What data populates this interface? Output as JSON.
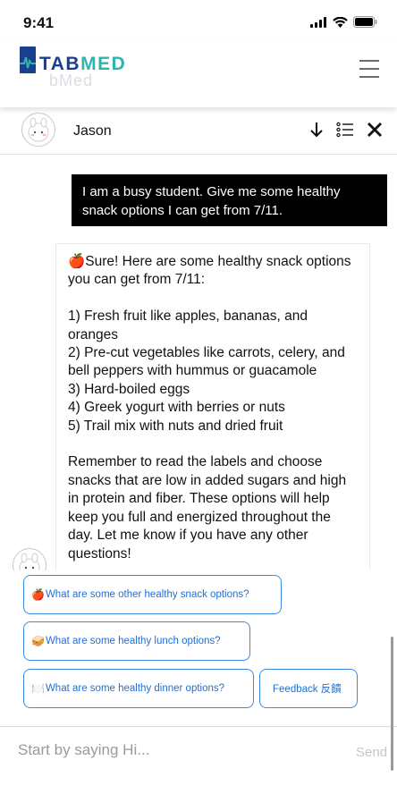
{
  "status_bar": {
    "time": "9:41"
  },
  "header": {
    "logo_part1": "TAB",
    "logo_part2": "MED",
    "logo_ghost": "bMed"
  },
  "chat": {
    "contact_name": "Jason",
    "user_message": "I am a busy student. Give me some healthy snack options I can get from 7/11.",
    "bot_message": "🍎Sure! Here are some healthy snack options you can get from 7/11:\n\n1) Fresh fruit like apples, bananas, and oranges\n2) Pre-cut vegetables like carrots, celery, and bell peppers with hummus or guacamole\n3) Hard-boiled eggs\n4) Greek yogurt with berries or nuts\n5) Trail mix with nuts and dried fruit\n\nRemember to read the labels and choose snacks that are low in added sugars and high in protein and fiber. These options will help keep you full and energized throughout the day. Let me know if you have any other questions!"
  },
  "suggestions": [
    {
      "emoji": "🍎",
      "label": "What are some other healthy snack options?"
    },
    {
      "emoji": "🥪",
      "label": "What are some healthy lunch options?"
    },
    {
      "emoji": "🍽️",
      "label": "What are some healthy dinner options?"
    }
  ],
  "feedback_label": "Feedback 反饋",
  "input": {
    "placeholder": "Start by saying Hi...",
    "send_label": "Send"
  },
  "colors": {
    "accent": "#3b8ae6",
    "brand_navy": "#1b3f8f",
    "brand_teal": "#2db5b0"
  },
  "icons": [
    "signal-icon",
    "wifi-icon",
    "battery-icon",
    "menu-icon",
    "arrow-down-icon",
    "list-icon",
    "close-icon"
  ]
}
